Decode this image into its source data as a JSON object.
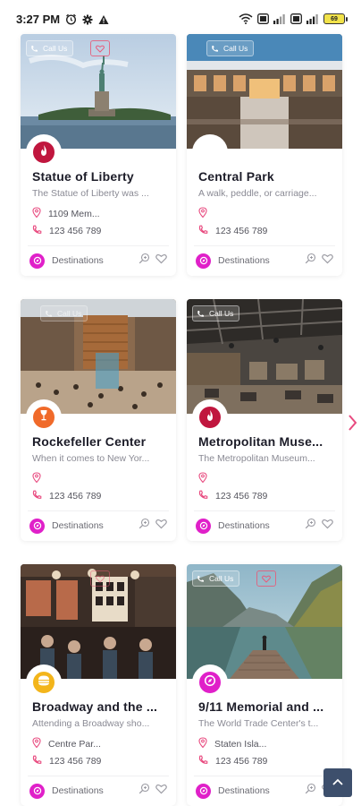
{
  "status_bar": {
    "time": "3:27 PM",
    "left_icons": [
      "alarm-icon",
      "settings-icon",
      "warning-icon"
    ],
    "right_icons": [
      "wifi-icon",
      "volte-icon",
      "signal-icon",
      "volte-icon",
      "signal-icon"
    ],
    "battery": "69"
  },
  "cards": [
    {
      "photo": "statue-of-liberty-photo",
      "call_label": "Call Us",
      "category_color": "#c0163e",
      "category_icon": "flame-icon",
      "title": "Statue of Liberty",
      "description": "The Statue of Liberty was ...",
      "address": "1109 Mem...",
      "phone": "123 456 789",
      "footer_label": "Destinations"
    },
    {
      "photo": "central-park-mall-photo",
      "call_label": "Call Us",
      "category_color": "#ffffff",
      "category_icon": "",
      "title": "Central Park",
      "description": "A walk, peddle, or carriage...",
      "address": "",
      "phone": "123 456 789",
      "footer_label": "Destinations"
    },
    {
      "photo": "rockefeller-center-photo",
      "call_label": "Call Us",
      "category_color": "#f06a2a",
      "category_icon": "wine-glass-icon",
      "title": "Rockefeller Center",
      "description": "When it comes to New Yor...",
      "address": "",
      "phone": "123 456 789",
      "footer_label": "Destinations"
    },
    {
      "photo": "metropolitan-museum-photo",
      "call_label": "Call Us",
      "category_color": "#c0163e",
      "category_icon": "flame-icon",
      "title": "Metropolitan Muse...",
      "description": "The Metropolitan Museum...",
      "address": "",
      "phone": "123 456 789",
      "footer_label": "Destinations"
    },
    {
      "photo": "broadway-restaurant-photo",
      "call_label": "",
      "category_color": "#f3b51b",
      "category_icon": "burger-icon",
      "title": "Broadway and the ...",
      "description": "Attending a Broadway sho...",
      "address": "Centre Par...",
      "phone": "123 456 789",
      "footer_label": "Destinations"
    },
    {
      "photo": "911-memorial-lake-photo",
      "call_label": "Call Us",
      "category_color": "#e020c9",
      "category_icon": "compass-icon",
      "title": "9/11 Memorial and ...",
      "description": "The World Trade Center's t...",
      "address": "Staten Isla...",
      "phone": "123 456 789",
      "footer_label": "Destinations"
    }
  ],
  "colors": {
    "accent_pink": "#e84a7f",
    "destination_magenta": "#e020c9",
    "scroll_button": "#3d4f6c"
  }
}
